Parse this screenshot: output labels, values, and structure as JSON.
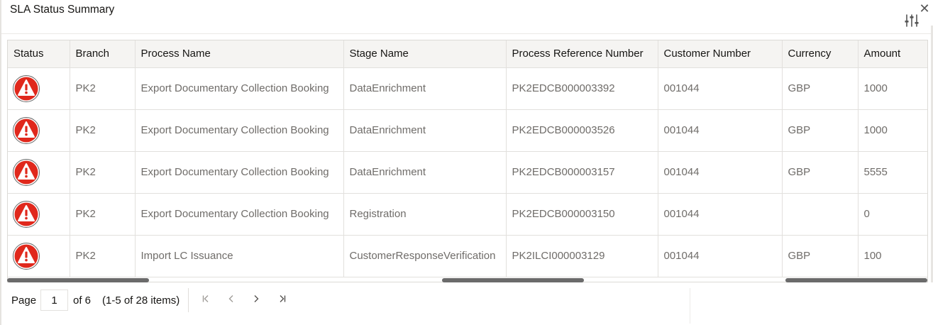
{
  "panel": {
    "title": "SLA Status Summary",
    "close_label": "✕"
  },
  "table": {
    "columns": [
      "Status",
      "Branch",
      "Process Name",
      "Stage Name",
      "Process Reference Number",
      "Customer Number",
      "Currency",
      "Amount"
    ],
    "rows": [
      {
        "status": "warning",
        "branch": "PK2",
        "process_name": "Export Documentary Collection Booking",
        "stage_name": "DataEnrichment",
        "ref": "PK2EDCB000003392",
        "customer": "001044",
        "currency": "GBP",
        "amount": "1000"
      },
      {
        "status": "warning",
        "branch": "PK2",
        "process_name": "Export Documentary Collection Booking",
        "stage_name": "DataEnrichment",
        "ref": "PK2EDCB000003526",
        "customer": "001044",
        "currency": "GBP",
        "amount": "1000"
      },
      {
        "status": "warning",
        "branch": "PK2",
        "process_name": "Export Documentary Collection Booking",
        "stage_name": "DataEnrichment",
        "ref": "PK2EDCB000003157",
        "customer": "001044",
        "currency": "GBP",
        "amount": "5555"
      },
      {
        "status": "warning",
        "branch": "PK2",
        "process_name": "Export Documentary Collection Booking",
        "stage_name": "Registration",
        "ref": "PK2EDCB000003150",
        "customer": "001044",
        "currency": "",
        "amount": "0"
      },
      {
        "status": "warning",
        "branch": "PK2",
        "process_name": "Import LC Issuance",
        "stage_name": "CustomerResponseVerification",
        "ref": "PK2ILCI000003129",
        "customer": "001044",
        "currency": "GBP",
        "amount": "100"
      }
    ]
  },
  "pager": {
    "page_label": "Page",
    "page_value": "1",
    "of_label": "of 6",
    "range_label": "(1-5 of 28 items)",
    "first_icon": "first-page-icon",
    "prev_icon": "previous-page-icon",
    "next_icon": "next-page-icon",
    "last_icon": "last-page-icon"
  },
  "colors": {
    "status_red": "#e0281c",
    "header_bg": "#f5f4f2",
    "cell_text": "#6f6c69"
  }
}
